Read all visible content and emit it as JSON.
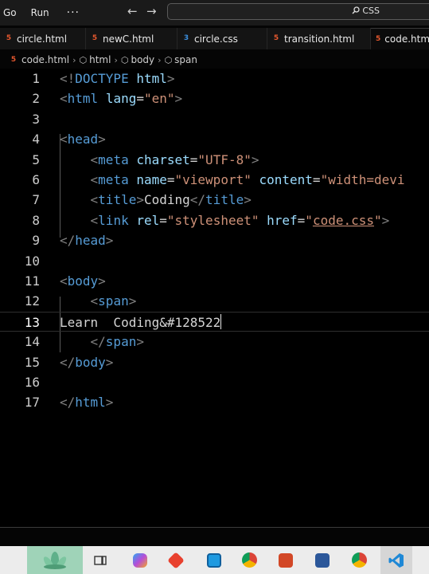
{
  "menubar": {
    "items": [
      "Go",
      "Run"
    ],
    "more_label": "···",
    "back_icon": "←",
    "forward_icon": "→"
  },
  "search": {
    "icon": "🔍",
    "text": "CSS"
  },
  "tabs": [
    {
      "label": "circle.html",
      "type": "html",
      "active": false
    },
    {
      "label": "newC.html",
      "type": "html",
      "active": false
    },
    {
      "label": "circle.css",
      "type": "css",
      "active": false
    },
    {
      "label": "transition.html",
      "type": "html",
      "active": false
    },
    {
      "label": "code.html",
      "type": "html",
      "active": true
    }
  ],
  "breadcrumb": {
    "file": "code.html",
    "items": [
      "html",
      "body",
      "span"
    ]
  },
  "editor": {
    "lines": [
      {
        "n": "1",
        "tokens": [
          [
            "t",
            "<!"
          ],
          [
            "tag",
            "DOCTYPE"
          ],
          [
            "txt",
            " "
          ],
          [
            "attr",
            "html"
          ],
          [
            "t",
            ">"
          ]
        ]
      },
      {
        "n": "2",
        "tokens": [
          [
            "t",
            "<"
          ],
          [
            "tag",
            "html"
          ],
          [
            "txt",
            " "
          ],
          [
            "attr",
            "lang"
          ],
          [
            "txt",
            "="
          ],
          [
            "str",
            "\"en\""
          ],
          [
            "t",
            ">"
          ]
        ]
      },
      {
        "n": "3",
        "tokens": []
      },
      {
        "n": "4",
        "tokens": [
          [
            "t",
            "<"
          ],
          [
            "tag",
            "head"
          ],
          [
            "t",
            ">"
          ]
        ]
      },
      {
        "n": "5",
        "tokens": [
          [
            "txt",
            "    "
          ],
          [
            "t",
            "<"
          ],
          [
            "tag",
            "meta"
          ],
          [
            "txt",
            " "
          ],
          [
            "attr",
            "charset"
          ],
          [
            "txt",
            "="
          ],
          [
            "str",
            "\"UTF-8\""
          ],
          [
            "t",
            ">"
          ]
        ]
      },
      {
        "n": "6",
        "tokens": [
          [
            "txt",
            "    "
          ],
          [
            "t",
            "<"
          ],
          [
            "tag",
            "meta"
          ],
          [
            "txt",
            " "
          ],
          [
            "attr",
            "name"
          ],
          [
            "txt",
            "="
          ],
          [
            "str",
            "\"viewport\""
          ],
          [
            "txt",
            " "
          ],
          [
            "attr",
            "content"
          ],
          [
            "txt",
            "="
          ],
          [
            "str",
            "\"width=devi"
          ]
        ]
      },
      {
        "n": "7",
        "tokens": [
          [
            "txt",
            "    "
          ],
          [
            "t",
            "<"
          ],
          [
            "tag",
            "title"
          ],
          [
            "t",
            ">"
          ],
          [
            "txt",
            "Coding"
          ],
          [
            "t",
            "</"
          ],
          [
            "tag",
            "title"
          ],
          [
            "t",
            ">"
          ]
        ]
      },
      {
        "n": "8",
        "tokens": [
          [
            "txt",
            "    "
          ],
          [
            "t",
            "<"
          ],
          [
            "tag",
            "link"
          ],
          [
            "txt",
            " "
          ],
          [
            "attr",
            "rel"
          ],
          [
            "txt",
            "="
          ],
          [
            "str",
            "\"stylesheet\""
          ],
          [
            "txt",
            " "
          ],
          [
            "attr",
            "href"
          ],
          [
            "txt",
            "="
          ],
          [
            "str",
            "\""
          ],
          [
            "strlink",
            "code.css"
          ],
          [
            "str",
            "\""
          ],
          [
            "t",
            ">"
          ]
        ]
      },
      {
        "n": "9",
        "tokens": [
          [
            "t",
            "</"
          ],
          [
            "tag",
            "head"
          ],
          [
            "t",
            ">"
          ]
        ]
      },
      {
        "n": "10",
        "tokens": []
      },
      {
        "n": "11",
        "tokens": [
          [
            "t",
            "<"
          ],
          [
            "tag",
            "body"
          ],
          [
            "t",
            ">"
          ]
        ]
      },
      {
        "n": "12",
        "tokens": [
          [
            "txt",
            "    "
          ],
          [
            "t",
            "<"
          ],
          [
            "tag",
            "span"
          ],
          [
            "t",
            ">"
          ]
        ]
      },
      {
        "n": "13",
        "tokens": [
          [
            "txt",
            "Learn  Coding"
          ],
          [
            "txt",
            "&#128522"
          ]
        ],
        "current": true
      },
      {
        "n": "14",
        "tokens": [
          [
            "txt",
            "    "
          ],
          [
            "t",
            "</"
          ],
          [
            "tag",
            "span"
          ],
          [
            "t",
            ">"
          ]
        ]
      },
      {
        "n": "15",
        "tokens": [
          [
            "t",
            "</"
          ],
          [
            "tag",
            "body"
          ],
          [
            "t",
            ">"
          ]
        ]
      },
      {
        "n": "16",
        "tokens": []
      },
      {
        "n": "17",
        "tokens": [
          [
            "t",
            "</"
          ],
          [
            "tag",
            "html"
          ],
          [
            "t",
            ">"
          ]
        ]
      }
    ]
  },
  "colors": {
    "html_icon": "#e4572e",
    "css_icon": "#3b8fde",
    "tag": "#569cd6",
    "attribute": "#9cdcfe",
    "string": "#ce9178",
    "punctuation": "#808080"
  },
  "taskbar": {
    "icons": [
      "lotus-icon",
      "task-view-icon",
      "copilot-icon",
      "anydesk-icon",
      "snipping-tool-icon",
      "chrome-icon",
      "powerpoint-icon",
      "word-icon",
      "chrome-profile-icon",
      "vscode-icon"
    ]
  }
}
